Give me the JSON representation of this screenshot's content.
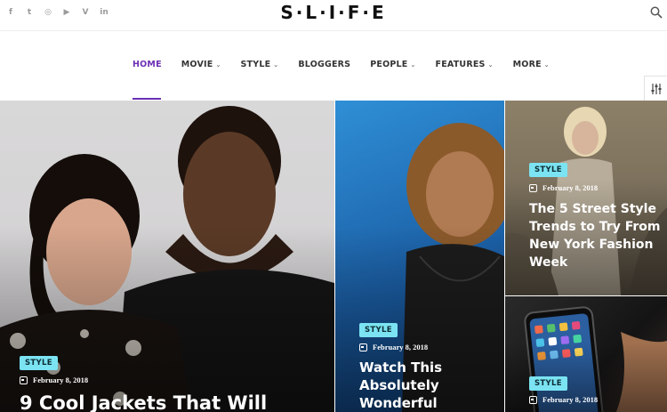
{
  "site": {
    "logo": "S·L·I·F·E"
  },
  "social_icons": [
    {
      "name": "facebook-icon",
      "glyph": "f"
    },
    {
      "name": "twitter-icon",
      "glyph": "t"
    },
    {
      "name": "instagram-icon",
      "glyph": "◎"
    },
    {
      "name": "youtube-icon",
      "glyph": "▶"
    },
    {
      "name": "vimeo-icon",
      "glyph": "V"
    },
    {
      "name": "linkedin-icon",
      "glyph": "in"
    }
  ],
  "nav": {
    "items": [
      {
        "label": "HOME",
        "active": true,
        "dropdown": false
      },
      {
        "label": "MOVIE",
        "active": false,
        "dropdown": true
      },
      {
        "label": "STYLE",
        "active": false,
        "dropdown": true
      },
      {
        "label": "BLOGGERS",
        "active": false,
        "dropdown": false
      },
      {
        "label": "PEOPLE",
        "active": false,
        "dropdown": true
      },
      {
        "label": "FEATURES",
        "active": false,
        "dropdown": true
      },
      {
        "label": "MORE",
        "active": false,
        "dropdown": true
      }
    ],
    "chevron": "⌄"
  },
  "colors": {
    "accent": "#6b2fb3",
    "badge": "#7be3f2"
  },
  "posts": [
    {
      "category": "STYLE",
      "date": "February 8, 2018",
      "title": "9 Cool Jackets That Will"
    },
    {
      "category": "STYLE",
      "date": "February 8, 2018",
      "title": "Watch This Absolutely Wonderful"
    },
    {
      "category": "STYLE",
      "date": "February 8, 2018",
      "title": "The 5 Street Style Trends to Try From New York Fashion Week"
    },
    {
      "category": "STYLE",
      "date": "February 8, 2018",
      "title": ""
    }
  ]
}
